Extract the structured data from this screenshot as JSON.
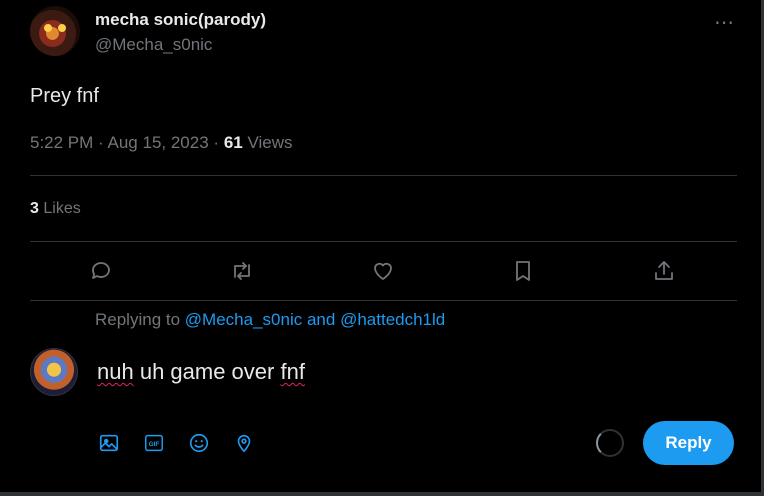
{
  "author": {
    "name": "mecha sonic(parody)",
    "handle": "@Mecha_s0nic",
    "more_icon": "⋯"
  },
  "tweet": {
    "text": "Prey fnf",
    "time": "5:22 PM",
    "date": "Aug 15, 2023",
    "sep": "·",
    "views_count": "61",
    "views_label": "Views",
    "likes_count": "3",
    "likes_label": "Likes"
  },
  "actions": [
    {
      "name": "reply-icon"
    },
    {
      "name": "retweet-icon"
    },
    {
      "name": "like-icon"
    },
    {
      "name": "bookmark-icon"
    },
    {
      "name": "share-icon"
    }
  ],
  "reply": {
    "replying_prefix": "Replying to",
    "replying_user1": "@Mecha_s0nic",
    "replying_and": "and",
    "replying_user2": "@hattedch1ld",
    "text_word1": "nuh",
    "text_middle": " uh game over ",
    "text_word2": "fnf",
    "button_label": "Reply",
    "tools": [
      "image-icon",
      "gif-icon",
      "emoji-icon",
      "location-icon"
    ]
  },
  "colors": {
    "accent": "#1d9bf0",
    "muted": "#71767b",
    "text": "#e7e9ea",
    "background": "#000000"
  }
}
